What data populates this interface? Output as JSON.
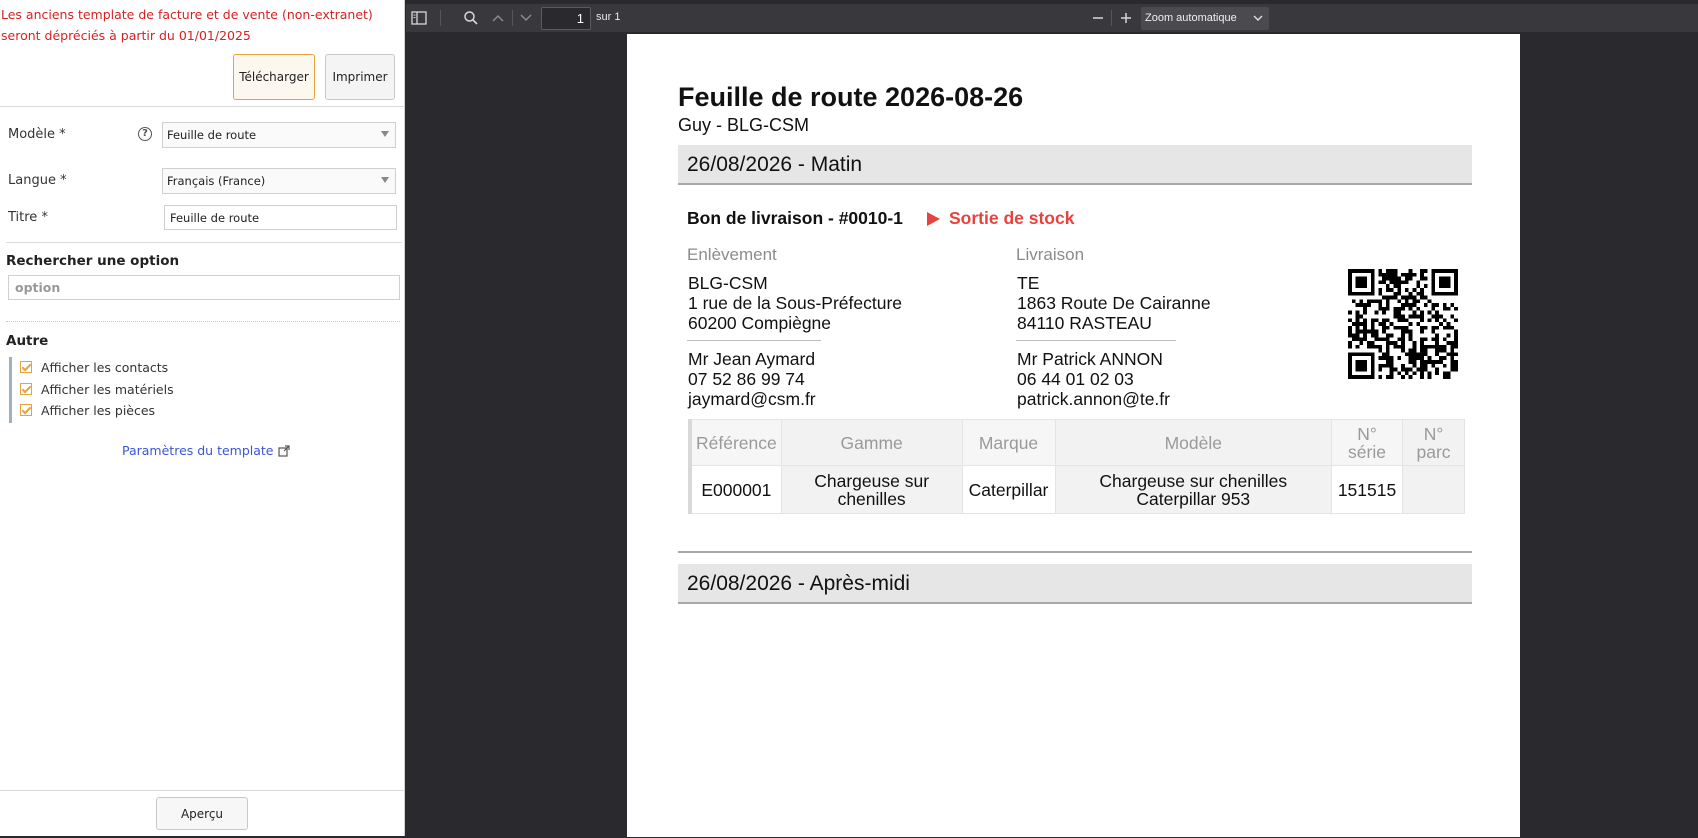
{
  "left_panel": {
    "warning": "Les anciens template de facture et de vente (non-extranet) seront dépréciés à partir du 01/01/2025",
    "download_label": "Télécharger",
    "print_label": "Imprimer",
    "model_label": "Modèle *",
    "model_value": "Feuille de route",
    "language_label": "Langue *",
    "language_value": "Français (France)",
    "title_label": "Titre *",
    "title_value": "Feuille de route",
    "search_title": "Rechercher une option",
    "search_placeholder": "option",
    "other_title": "Autre",
    "options": [
      {
        "label": "Afficher les contacts",
        "checked": true
      },
      {
        "label": "Afficher les matériels",
        "checked": true
      },
      {
        "label": "Afficher les pièces",
        "checked": true
      }
    ],
    "template_link": "Paramètres du template",
    "preview_label": "Aperçu"
  },
  "pdf_toolbar": {
    "page_number": "1",
    "page_total": "sur 1",
    "zoom": "Zoom automatique"
  },
  "document": {
    "title": "Feuille de route 2026-08-26",
    "subtitle": "Guy - BLG-CSM",
    "section_morning": "26/08/2026 - Matin",
    "section_afternoon": "26/08/2026 - Après-midi",
    "delivery_note": "Bon de livraison - #0010-1",
    "stock_status": "Sortie de stock",
    "pickup": {
      "heading": "Enlèvement",
      "name": "BLG-CSM",
      "street": "1 rue de la Sous-Préfecture",
      "city": "60200 Compiègne",
      "contact": "Mr Jean Aymard",
      "phone": "07 52 86 99 74",
      "email": "jaymard@csm.fr"
    },
    "delivery": {
      "heading": "Livraison",
      "name": "TE",
      "street": "1863 Route De Cairanne",
      "city": "84110 RASTEAU",
      "contact": "Mr Patrick ANNON",
      "phone": "06 44 01 02 03",
      "email": "patrick.annon@te.fr"
    },
    "table": {
      "headers": [
        "Référence",
        "Gamme",
        "Marque",
        "Modèle",
        "N° série",
        "N° parc"
      ],
      "rows": [
        [
          "E000001",
          "Chargeuse sur chenilles",
          "Caterpillar",
          "Chargeuse sur chenilles Caterpillar 953",
          "151515",
          ""
        ]
      ]
    }
  },
  "colors": {
    "warning": "#d62222",
    "accent": "#e8a33c",
    "stock_out": "#e8423f",
    "link": "#3b55d9"
  }
}
